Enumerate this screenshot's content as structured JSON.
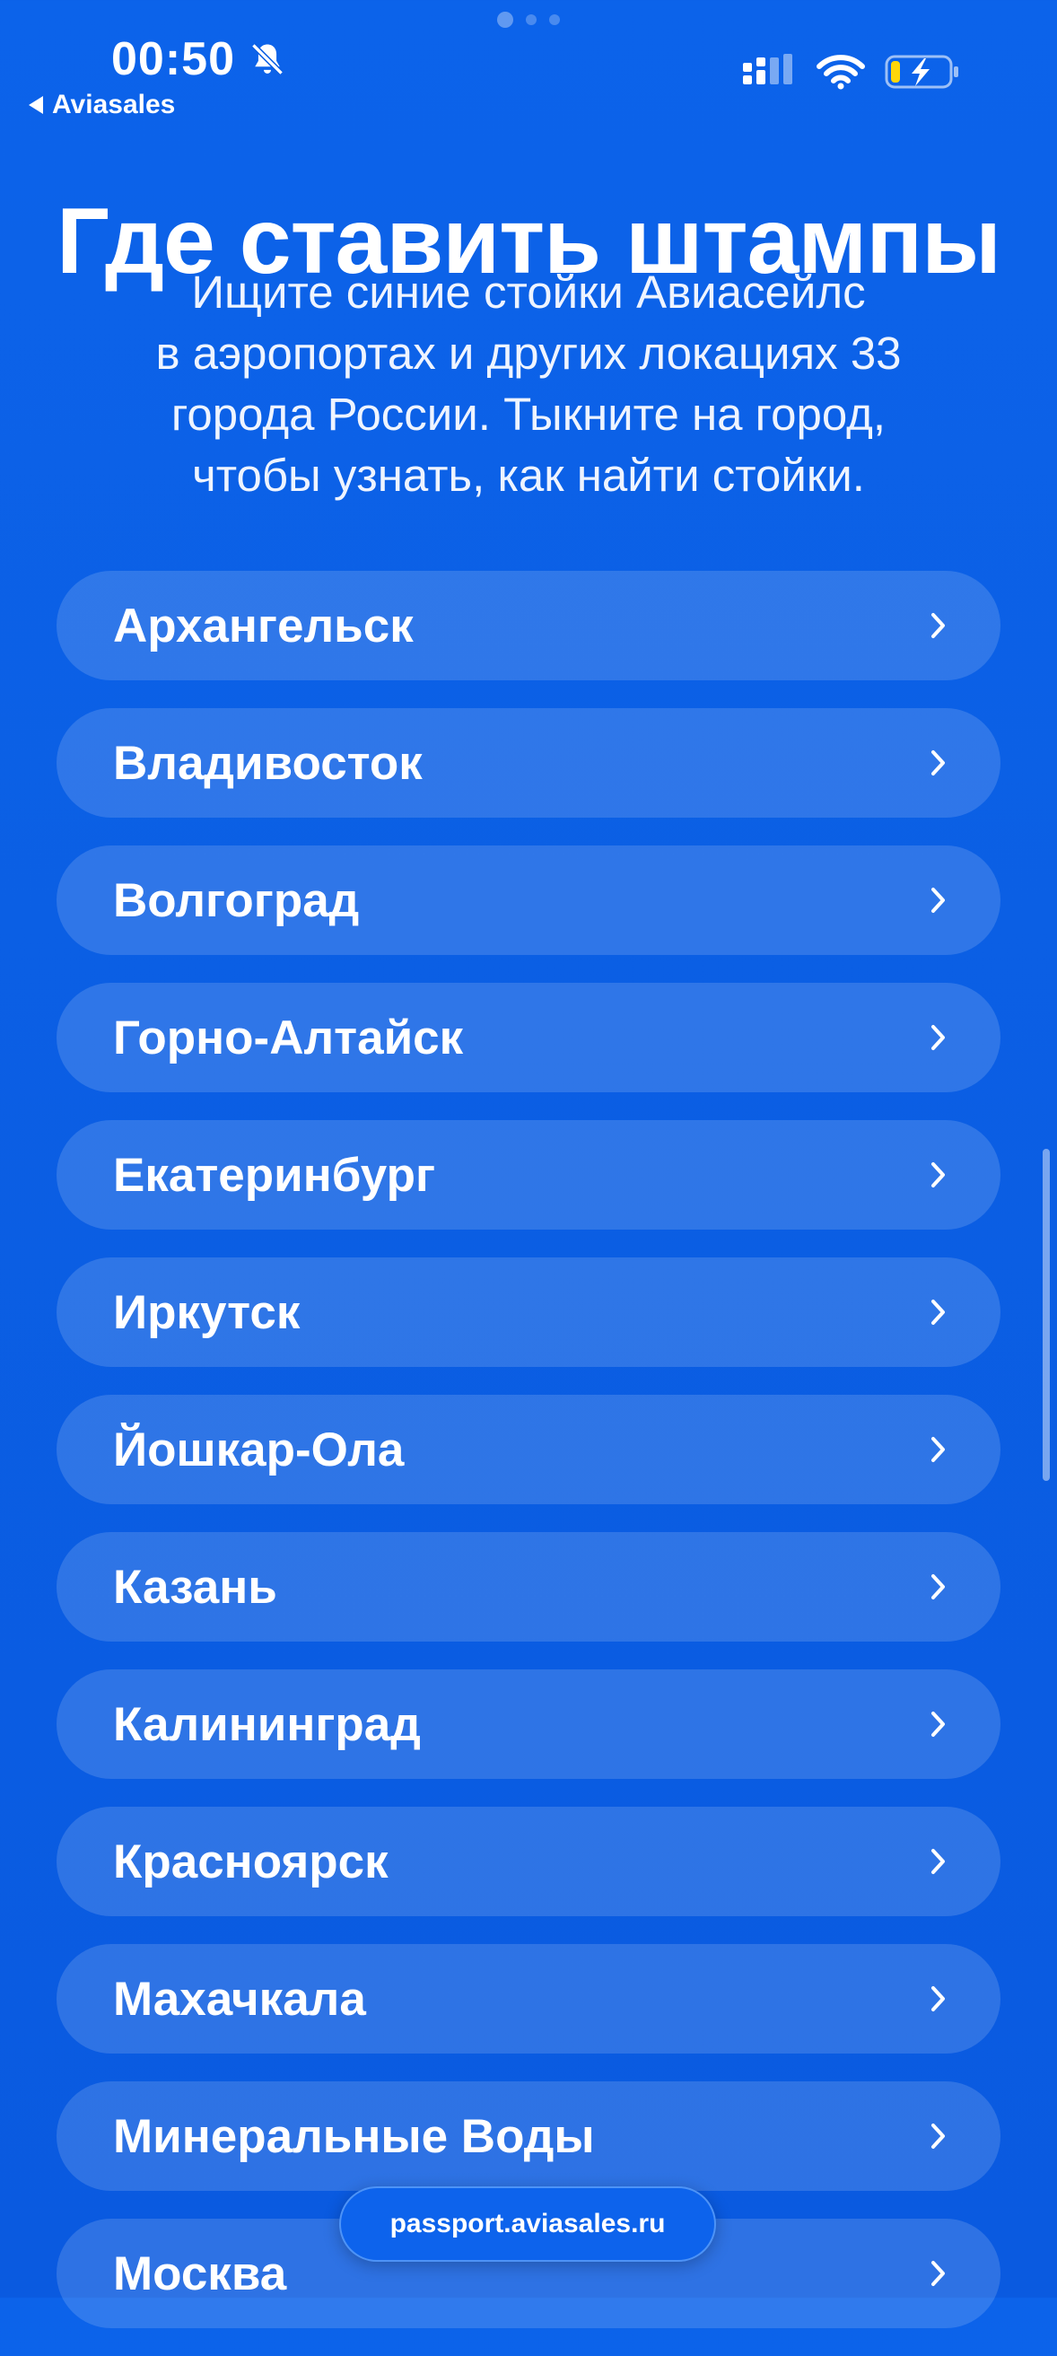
{
  "status_bar": {
    "time": "00:50",
    "back_app": "Aviasales"
  },
  "icons": {
    "bell": "bell-slash-icon",
    "signal": "cellular-signal-icon",
    "wifi": "wifi-icon",
    "battery": "battery-charging-icon",
    "chevron": "chevron-right-icon"
  },
  "page": {
    "title": "Где ставить штампы",
    "description_lines": [
      "Ищите синие стойки Авиасейлс",
      "в аэропортах и других локациях 33",
      "города России. Тыкните на город,",
      "чтобы узнать, как найти стойки."
    ]
  },
  "cities": [
    {
      "name": "Архангельск"
    },
    {
      "name": "Владивосток"
    },
    {
      "name": "Волгоград"
    },
    {
      "name": "Горно-Алтайск"
    },
    {
      "name": "Екатеринбург"
    },
    {
      "name": "Иркутск"
    },
    {
      "name": "Йошкар-Ола"
    },
    {
      "name": "Казань"
    },
    {
      "name": "Калининград"
    },
    {
      "name": "Красноярск"
    },
    {
      "name": "Махачкала"
    },
    {
      "name": "Минеральные Воды"
    },
    {
      "name": "Москва"
    }
  ],
  "browser": {
    "url": "passport.aviasales.ru"
  },
  "colors": {
    "background": "#0b5fe4",
    "item_background": "rgba(255,255,255,0.15)",
    "text": "#ffffff",
    "battery_level": "#ffd60a"
  }
}
